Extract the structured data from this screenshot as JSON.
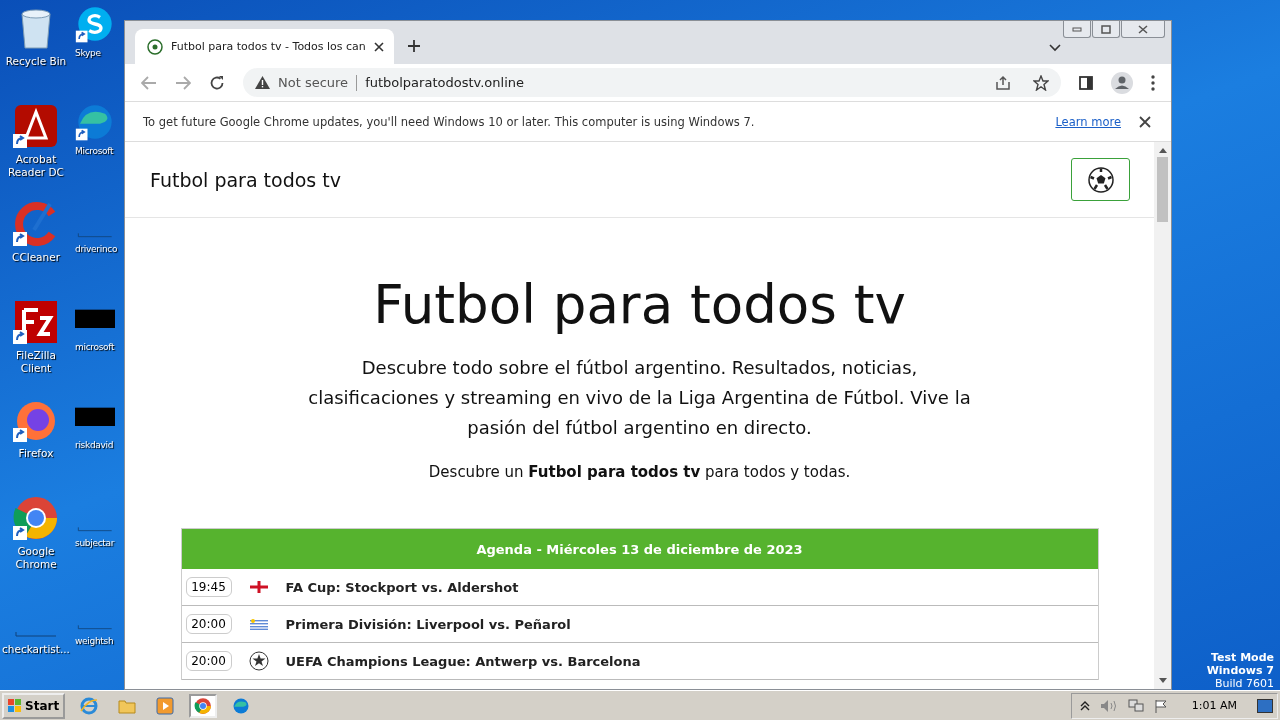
{
  "desktop": {
    "icons": [
      {
        "label": "Recycle Bin",
        "kind": "bin",
        "shortcut": false
      },
      {
        "label": "Acrobat Reader DC",
        "kind": "acrobat",
        "shortcut": true
      },
      {
        "label": "CCleaner",
        "kind": "ccleaner",
        "shortcut": true
      },
      {
        "label": "FileZilla Client",
        "kind": "filezilla",
        "shortcut": true
      },
      {
        "label": "Firefox",
        "kind": "firefox",
        "shortcut": true
      },
      {
        "label": "Google Chrome",
        "kind": "chrome",
        "shortcut": true
      },
      {
        "label": "checkartist...",
        "kind": "file",
        "shortcut": false
      },
      {
        "label": "Skype",
        "kind": "skype",
        "shortcut": true
      },
      {
        "label": "Microsoft",
        "kind": "edge",
        "shortcut": true
      },
      {
        "label": "driverinco",
        "kind": "file",
        "shortcut": false
      },
      {
        "label": "microsoft",
        "kind": "redacted",
        "shortcut": false
      },
      {
        "label": "riskdavid",
        "kind": "redacted",
        "shortcut": false
      },
      {
        "label": "subjectar",
        "kind": "file",
        "shortcut": false
      },
      {
        "label": "weightsh",
        "kind": "file",
        "shortcut": false
      }
    ],
    "watermark": [
      "Test Mode",
      "Windows 7",
      "Build 7601"
    ]
  },
  "browser": {
    "tabs": [
      {
        "title": "Futbol para todos tv - Todos los can",
        "selected": true
      }
    ],
    "address": {
      "security": "Not secure",
      "url": "futbolparatodostv.online"
    },
    "infobar": {
      "message": "To get future Google Chrome updates, you'll need Windows 10 or later. This computer is using Windows 7.",
      "link": "Learn more"
    }
  },
  "page": {
    "brand": "Futbol para todos tv",
    "hero": {
      "title": "Futbol para todos tv",
      "text": "Descubre todo sobre el fútbol argentino. Resultados, noticias, clasificaciones y streaming en vivo de la Liga Argentina de Fútbol. Vive la pasión del fútbol argentino en directo.",
      "tagline": "Descubre un **Futbol para todos tv** para todos y todas."
    },
    "agenda": {
      "title": "Agenda - Miércoles 13 de diciembre de 2023",
      "rows": [
        {
          "time": "19:45",
          "kind": "england",
          "match": "FA Cup: Stockport vs. Aldershot"
        },
        {
          "time": "20:00",
          "kind": "uruguay",
          "match": "Primera División: Liverpool vs. Peñarol"
        },
        {
          "time": "20:00",
          "kind": "ucl",
          "match": "UEFA Champions League: Antwerp vs. Barcelona"
        }
      ]
    }
  },
  "taskbar": {
    "start": "Start",
    "apps": [
      {
        "kind": "ie",
        "selected": false
      },
      {
        "kind": "explorer",
        "selected": false
      },
      {
        "kind": "media",
        "selected": false
      },
      {
        "kind": "chrome",
        "selected": true
      },
      {
        "kind": "edge",
        "selected": false
      }
    ],
    "clock": "1:01 AM"
  }
}
